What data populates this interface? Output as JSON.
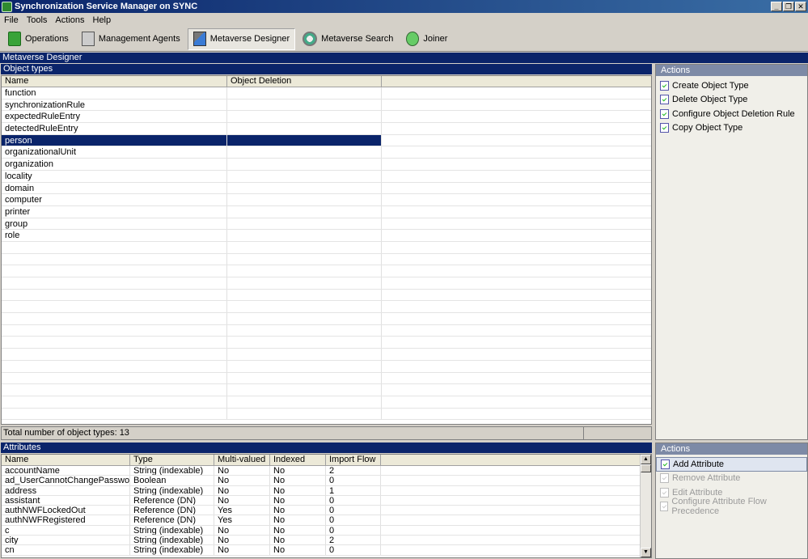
{
  "window": {
    "title": "Synchronization Service Manager on SYNC",
    "buttons": [
      "_",
      "❐",
      "✕"
    ]
  },
  "menu": [
    "File",
    "Tools",
    "Actions",
    "Help"
  ],
  "toolbar": [
    {
      "label": "Operations",
      "icon": "operations-icon"
    },
    {
      "label": "Management Agents",
      "icon": "management-agents-icon"
    },
    {
      "label": "Metaverse Designer",
      "icon": "metaverse-designer-icon",
      "active": true
    },
    {
      "label": "Metaverse Search",
      "icon": "metaverse-search-icon"
    },
    {
      "label": "Joiner",
      "icon": "joiner-icon"
    }
  ],
  "section_title": "Metaverse Designer",
  "object_types": {
    "header": "Object types",
    "columns": [
      "Name",
      "Object Deletion"
    ],
    "rows": [
      "function",
      "synchronizationRule",
      "expectedRuleEntry",
      "detectedRuleEntry",
      "person",
      "organizationalUnit",
      "organization",
      "locality",
      "domain",
      "computer",
      "printer",
      "group",
      "role"
    ],
    "selected": "person",
    "status": "Total number of object types: 13"
  },
  "actions_top": {
    "header": "Actions",
    "items": [
      "Create Object Type",
      "Delete Object Type",
      "Configure Object Deletion Rule",
      "Copy Object Type"
    ]
  },
  "attributes": {
    "header": "Attributes",
    "columns": [
      "Name",
      "Type",
      "Multi-valued",
      "Indexed",
      "Import Flow"
    ],
    "rows": [
      [
        "accountName",
        "String (indexable)",
        "No",
        "No",
        "2"
      ],
      [
        "ad_UserCannotChangePassword",
        "Boolean",
        "No",
        "No",
        "0"
      ],
      [
        "address",
        "String (indexable)",
        "No",
        "No",
        "1"
      ],
      [
        "assistant",
        "Reference (DN)",
        "No",
        "No",
        "0"
      ],
      [
        "authNWFLockedOut",
        "Reference (DN)",
        "Yes",
        "No",
        "0"
      ],
      [
        "authNWFRegistered",
        "Reference (DN)",
        "Yes",
        "No",
        "0"
      ],
      [
        "c",
        "String (indexable)",
        "No",
        "No",
        "0"
      ],
      [
        "city",
        "String (indexable)",
        "No",
        "No",
        "2"
      ],
      [
        "cn",
        "String (indexable)",
        "No",
        "No",
        "0"
      ]
    ]
  },
  "actions_bottom": {
    "header": "Actions",
    "items": [
      {
        "label": "Add Attribute",
        "enabled": true
      },
      {
        "label": "Remove Attribute",
        "enabled": false
      },
      {
        "label": "Edit Attribute",
        "enabled": false
      },
      {
        "label": "Configure Attribute Flow Precedence",
        "enabled": false
      }
    ]
  }
}
